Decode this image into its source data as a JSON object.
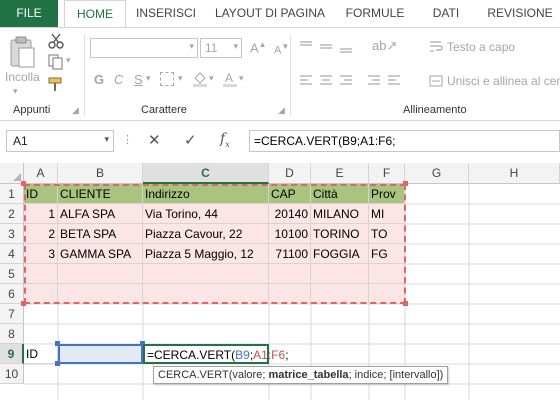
{
  "tabs": {
    "file": "FILE",
    "home": "HOME",
    "insert": "INSERISCI",
    "layout": "LAYOUT DI PAGINA",
    "formulas": "FORMULE",
    "data": "DATI",
    "review": "REVISIONE"
  },
  "ribbon": {
    "paste_label": "Incolla",
    "clipboard_group": "Appunti",
    "font_group": "Carattere",
    "font_size": "11",
    "bold": "G",
    "italic": "C",
    "underline": "S",
    "alignment_group": "Allineamento",
    "wrap_text": "Testo a capo",
    "merge_center": "Unisci e allinea al centr"
  },
  "formula_bar": {
    "name_box": "A1",
    "formula": "=CERCA.VERT(B9;A1:F6;"
  },
  "columns": [
    "A",
    "B",
    "C",
    "D",
    "E",
    "F",
    "G",
    "H"
  ],
  "rows": [
    "1",
    "2",
    "3",
    "4",
    "5",
    "6",
    "7",
    "8",
    "9",
    "10"
  ],
  "table": {
    "headers": [
      "ID",
      "CLIENTE",
      "Indirizzo",
      "CAP",
      "Città",
      "Prov"
    ],
    "rows": [
      [
        "1",
        "ALFA SPA",
        "Via Torino, 44",
        "20140",
        "MILANO",
        "MI"
      ],
      [
        "2",
        "BETA SPA",
        "Piazza Cavour, 22",
        "10100",
        "TORINO",
        "TO"
      ],
      [
        "3",
        "GAMMA SPA",
        "Piazza 5 Maggio, 12",
        "71100",
        "FOGGIA",
        "FG"
      ]
    ]
  },
  "row9": {
    "a": "ID",
    "formula_prefix": "=CERCA.VERT(",
    "ref1": "B9",
    "sep1": ";",
    "ref2": "A1:F6",
    "sep2": ";"
  },
  "tooltip": {
    "fn": "CERCA.VERT(",
    "arg1": "valore; ",
    "arg2": "matrice_tabella",
    "rest": "; indice; [intervallo])"
  },
  "colors": {
    "accent": "#217346",
    "header_fill": "#a9c47f",
    "range_fill": "#fbe5e5",
    "range_border": "#e06666",
    "ref_blue": "#4472c4",
    "ref_red": "#c0504d"
  }
}
